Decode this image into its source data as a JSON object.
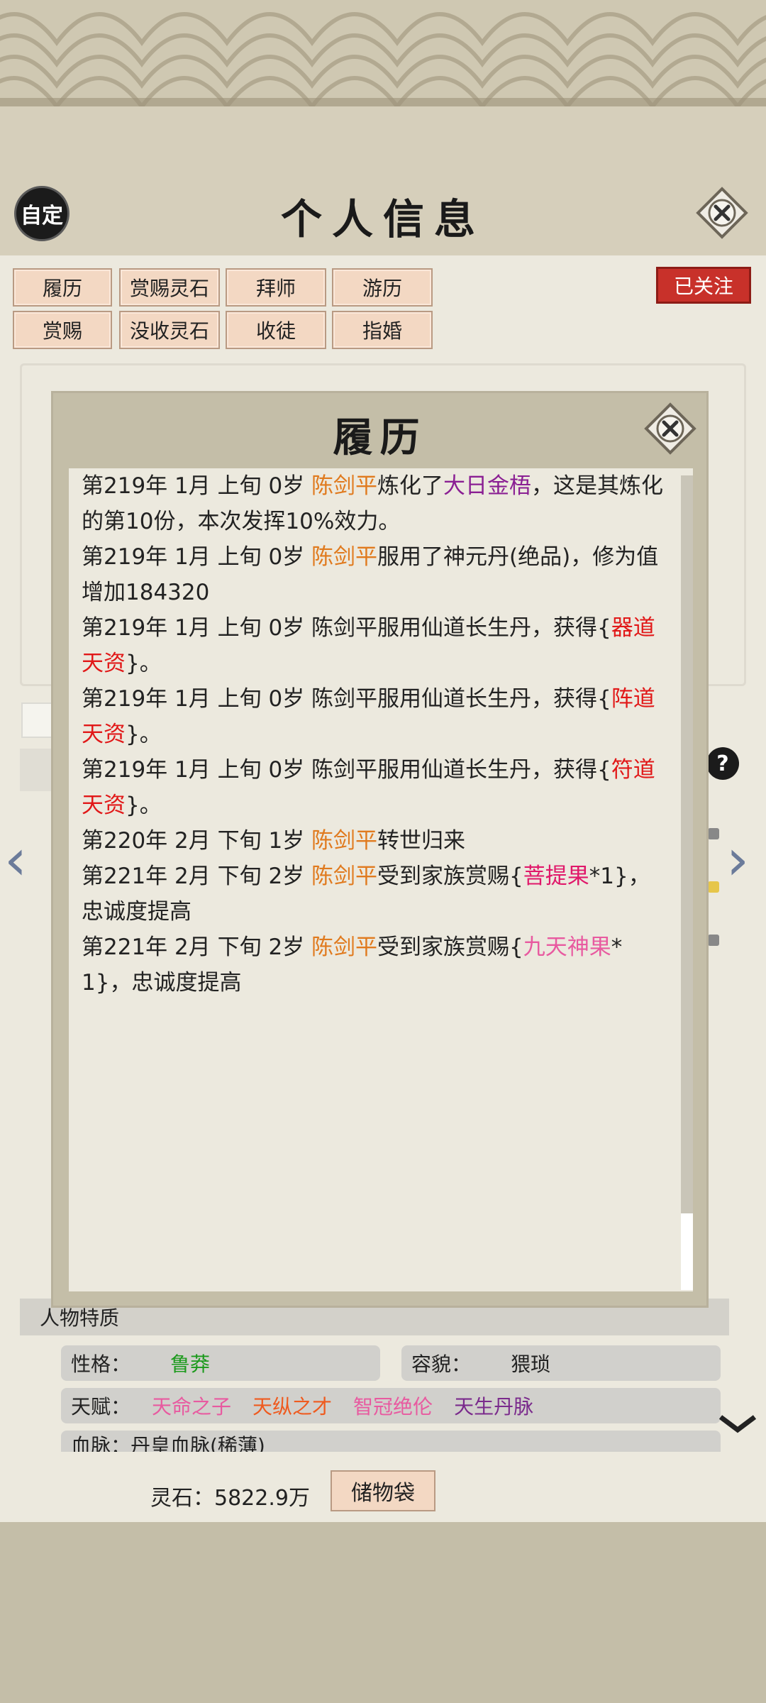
{
  "header": {
    "title": "个人信息",
    "custom_label": "自定",
    "follow_label": "已关注"
  },
  "tabs": [
    "履历",
    "赏赐灵石",
    "拜师",
    "游历",
    "赏赐",
    "没收灵石",
    "收徒",
    "指婚"
  ],
  "modal": {
    "title": "履历",
    "entries": [
      [
        {
          "t": "第219年 1月 上旬  0岁  "
        },
        {
          "t": "陈剑平",
          "c": "orange"
        },
        {
          "t": "炼化了"
        },
        {
          "t": "大日金梧",
          "c": "purple"
        },
        {
          "t": "，这是其炼化的第10份，本次发挥10%效力。"
        }
      ],
      [
        {
          "t": "第219年 1月 上旬  0岁  "
        },
        {
          "t": "陈剑平",
          "c": "orange"
        },
        {
          "t": "服用了神元丹(绝品)，修为值增加184320"
        }
      ],
      [
        {
          "t": "第219年 1月 上旬  0岁  陈剑平服用仙道长生丹，获得{"
        },
        {
          "t": "器道天资",
          "c": "red"
        },
        {
          "t": "}。"
        }
      ],
      [
        {
          "t": "第219年 1月 上旬  0岁  陈剑平服用仙道长生丹，获得{"
        },
        {
          "t": "阵道天资",
          "c": "red"
        },
        {
          "t": "}。"
        }
      ],
      [
        {
          "t": "第219年 1月 上旬  0岁  陈剑平服用仙道长生丹，获得{"
        },
        {
          "t": "符道天资",
          "c": "red"
        },
        {
          "t": "}。"
        }
      ],
      [
        {
          "t": "第220年 2月  下旬  1岁  "
        },
        {
          "t": "陈剑平",
          "c": "orange"
        },
        {
          "t": "转世归来"
        }
      ],
      [
        {
          "t": "第221年 2月  下旬  2岁  "
        },
        {
          "t": "陈剑平",
          "c": "orange"
        },
        {
          "t": "受到家族赏赐{"
        },
        {
          "t": "菩提果",
          "c": "pink"
        },
        {
          "t": "*1}，忠诚度提高"
        }
      ],
      [
        {
          "t": "第221年 2月 下旬  2岁  "
        },
        {
          "t": "陈剑平",
          "c": "orange"
        },
        {
          "t": "受到家族赏赐{"
        },
        {
          "t": "九天神果",
          "c": "mauve"
        },
        {
          "t": "*1}，忠诚度提高"
        }
      ]
    ]
  },
  "traits": {
    "section_title": "人物特质",
    "personality_label": "性格：",
    "personality_value": "鲁莽",
    "appearance_label": "容貌：",
    "appearance_value": "猥琐",
    "talent_label": "天赋：",
    "talents": [
      {
        "name": "天命之子",
        "color": "#e85aa0"
      },
      {
        "name": "天纵之才",
        "color": "#ef5a1e"
      },
      {
        "name": "智冠绝伦",
        "color": "#e85aa0"
      },
      {
        "name": "天生丹脉",
        "color": "#7a2a8c"
      }
    ],
    "bloodline_text": "血脉：丹皇血脉(稀薄)"
  },
  "footer": {
    "money": "灵石：5822.9万",
    "bag_label": "储物袋"
  },
  "colors": {
    "orange": "#e07a1e",
    "purple": "#8a1f93",
    "red": "#e11818",
    "pink": "#e0186a",
    "mauve": "#e85aa0",
    "follow_bg": "#c8312a",
    "button_bg": "#f3d8c3"
  }
}
